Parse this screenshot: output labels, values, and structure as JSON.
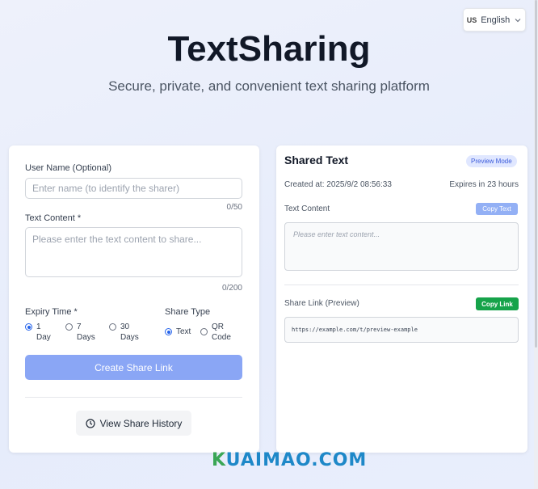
{
  "header": {
    "title": "TextSharing",
    "subtitle": "Secure, private, and convenient text sharing platform"
  },
  "language": {
    "flag": "US",
    "label": "English"
  },
  "form": {
    "username_label": "User Name (Optional)",
    "username_placeholder": "Enter name (to identify the sharer)",
    "username_counter": "0/50",
    "content_label": "Text Content *",
    "content_placeholder": "Please enter the text content to share...",
    "content_counter": "0/200",
    "expiry_label": "Expiry Time *",
    "expiry_options": [
      {
        "line1": "1",
        "line2": "Day",
        "selected": true
      },
      {
        "line1": "7",
        "line2": "Days",
        "selected": false
      },
      {
        "line1": "30",
        "line2": "Days",
        "selected": false
      }
    ],
    "share_type_label": "Share Type",
    "share_type_options": [
      {
        "line1": "Text",
        "line2": "",
        "selected": true
      },
      {
        "line1": "QR",
        "line2": "Code",
        "selected": false
      }
    ],
    "create_button": "Create Share Link",
    "history_button": "View Share History"
  },
  "preview": {
    "title": "Shared Text",
    "badge": "Preview Mode",
    "created_at": "Created at: 2025/9/2 08:56:33",
    "expires": "Expires in 23 hours",
    "content_label": "Text Content",
    "copy_text_button": "Copy Text",
    "content_placeholder": "Please enter text content...",
    "link_label": "Share Link (Preview)",
    "copy_link_button": "Copy Link",
    "link_value": "https://example.com/t/preview-example"
  },
  "watermark": {
    "first": "K",
    "rest": "UAIMAO.COM"
  },
  "colors": {
    "primary": "#2563eb",
    "create_button": "#8aa6f5",
    "copy_link": "#16a34a",
    "badge_bg": "#e0e7ff"
  }
}
